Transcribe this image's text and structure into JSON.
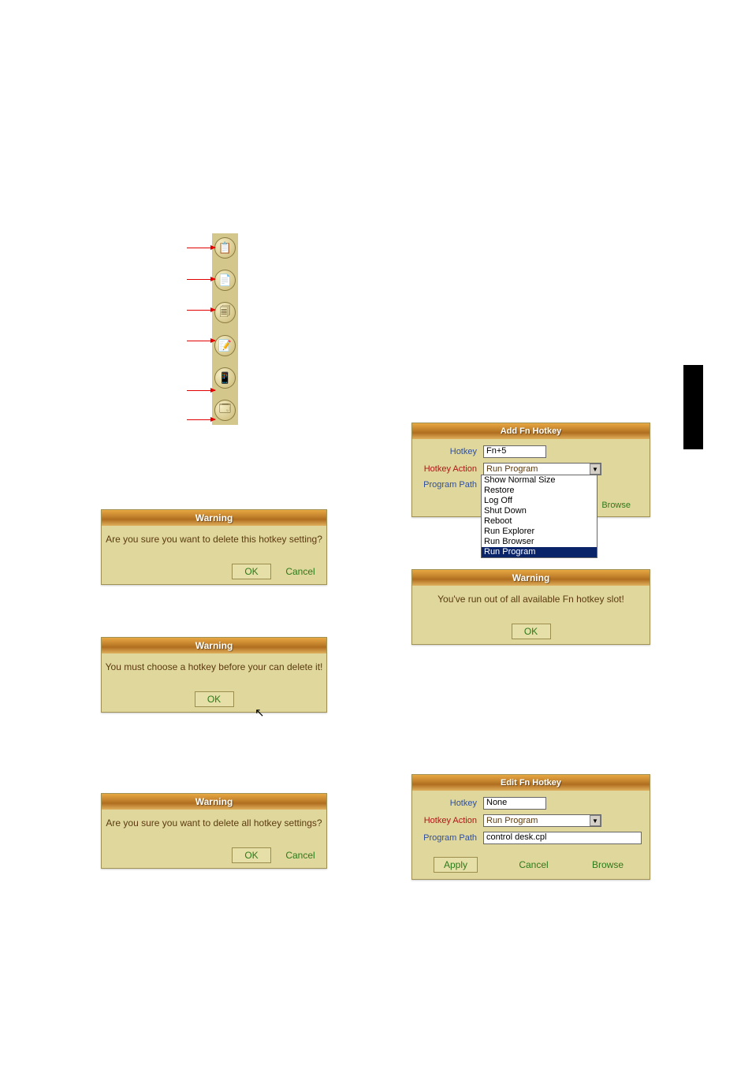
{
  "toolbar": {
    "items": [
      {
        "name": "clipboard-icon",
        "glyph": "📋"
      },
      {
        "name": "paste-icon",
        "glyph": "📄"
      },
      {
        "name": "copy-icon",
        "glyph": "🗐"
      },
      {
        "name": "note-icon",
        "glyph": "📝"
      },
      {
        "name": "device-icon",
        "glyph": "📱"
      },
      {
        "name": "grid-icon",
        "glyph": "🗔"
      }
    ]
  },
  "dialogs": {
    "delete_one": {
      "title": "Warning",
      "message": "Are you sure you want to delete this hotkey setting?",
      "ok": "OK",
      "cancel": "Cancel"
    },
    "choose_first": {
      "title": "Warning",
      "message": "You must choose a hotkey before your can delete it!",
      "ok": "OK"
    },
    "delete_all": {
      "title": "Warning",
      "message": "Are you sure you want to delete all hotkey settings?",
      "ok": "OK",
      "cancel": "Cancel"
    },
    "out_of_slots": {
      "title": "Warning",
      "message": "You've run out of all available Fn hotkey slot!",
      "ok": "OK"
    },
    "add_hotkey": {
      "title": "Add Fn Hotkey",
      "labels": {
        "hotkey": "Hotkey",
        "action": "Hotkey Action",
        "path": "Program Path"
      },
      "hotkey_value": "Fn+5",
      "action_value": "Run Program",
      "browse": "Browse",
      "options": [
        "Show Normal Size",
        "Restore",
        "Log Off",
        "Shut Down",
        "Reboot",
        "Run Explorer",
        "Run Browser",
        "Run Program"
      ]
    },
    "edit_hotkey": {
      "title": "Edit Fn Hotkey",
      "labels": {
        "hotkey": "Hotkey",
        "action": "Hotkey Action",
        "path": "Program Path"
      },
      "hotkey_value": "None",
      "action_value": "Run Program",
      "path_value": "control desk.cpl",
      "apply": "Apply",
      "cancel": "Cancel",
      "browse": "Browse"
    }
  }
}
